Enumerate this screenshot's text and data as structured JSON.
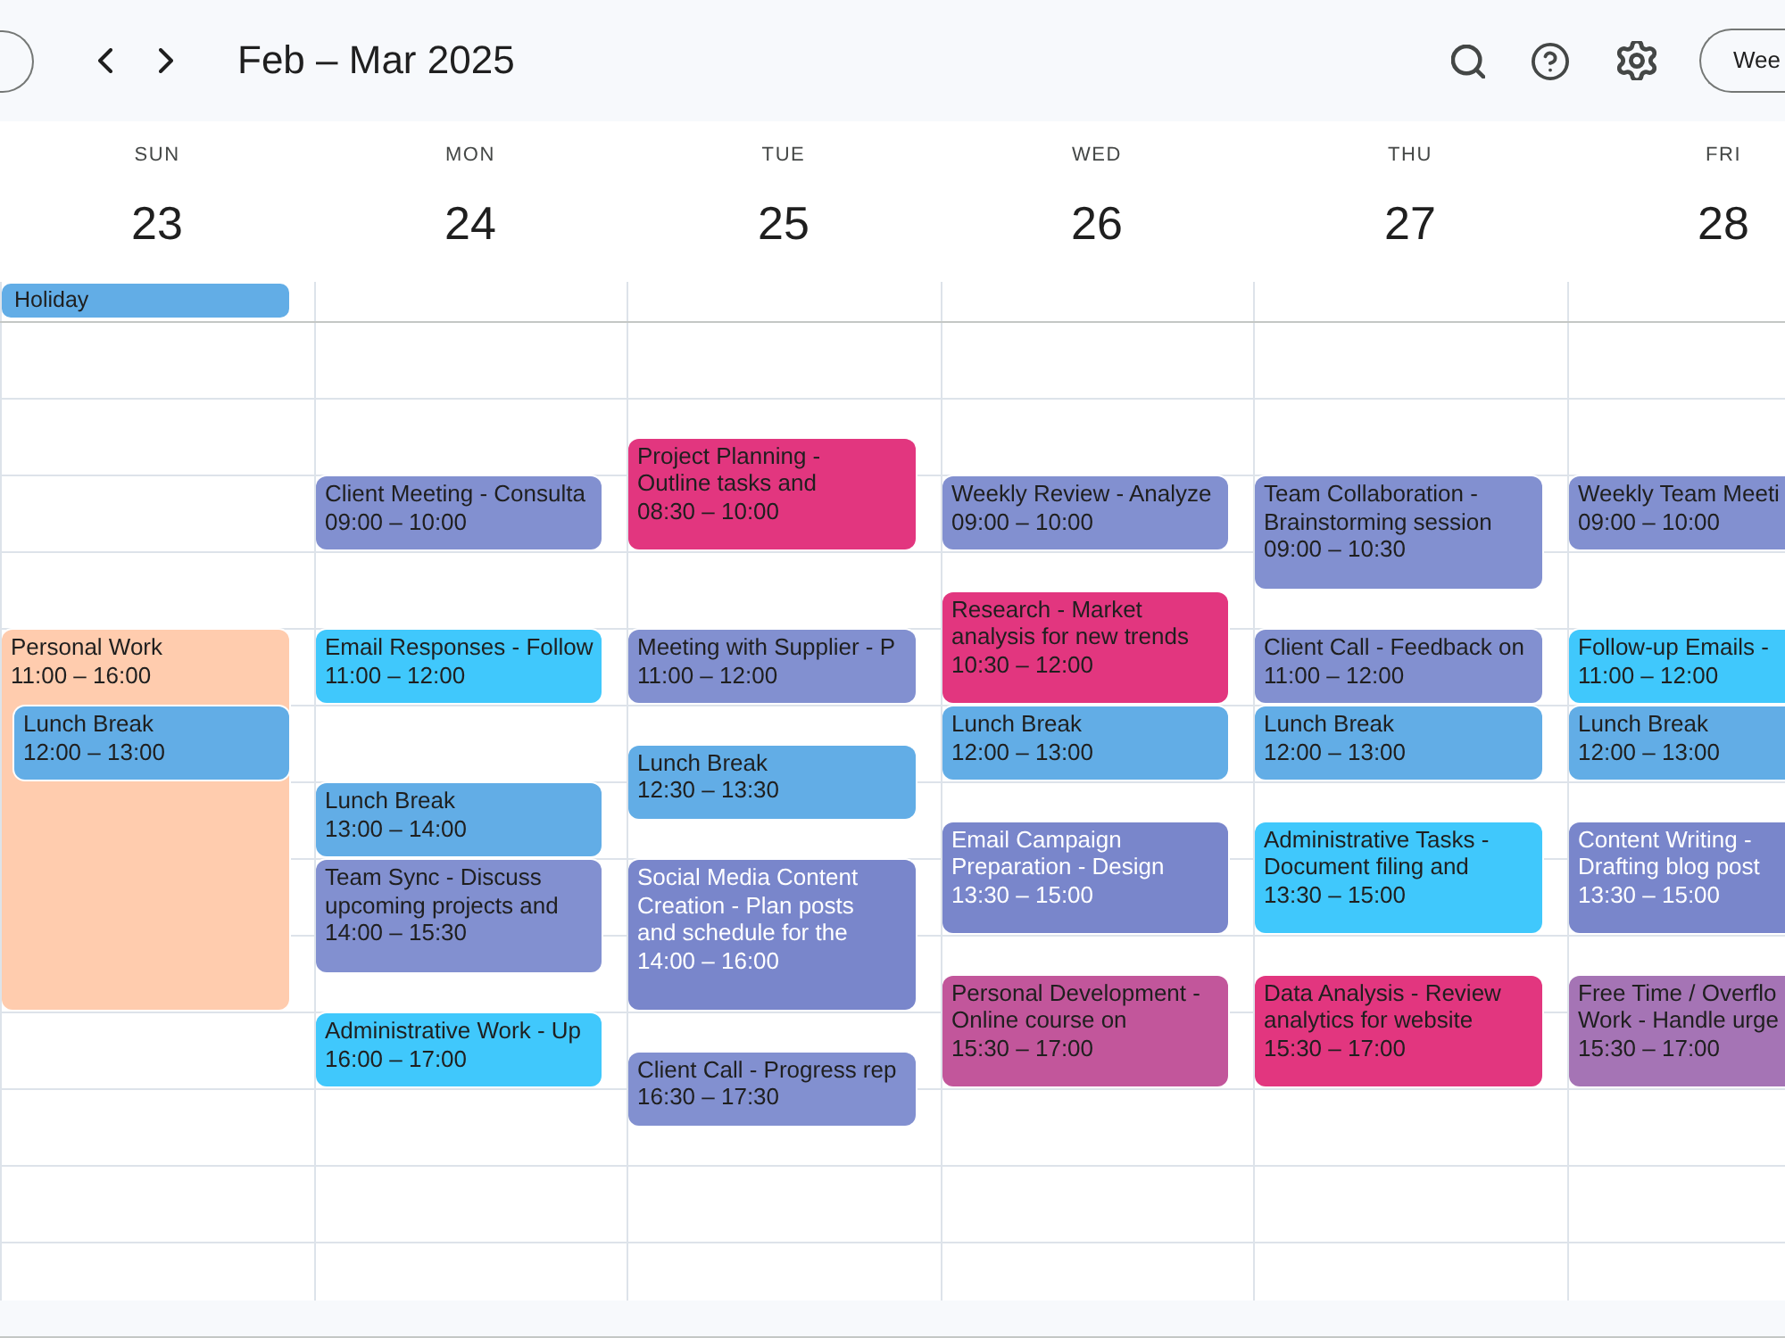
{
  "toolbar": {
    "title": "Feb – Mar 2025",
    "view_button": "Wee"
  },
  "days": [
    {
      "name": "SUN",
      "number": "23",
      "all_day": [
        {
          "title": "Holiday",
          "color": "#62ade6"
        }
      ],
      "events": [
        {
          "title": "Personal Work",
          "time": "11:00 – 16:00",
          "color": "#ffccae",
          "light_text": false
        },
        {
          "title": "Lunch Break",
          "time": "12:00 – 13:00",
          "color": "#62ade6",
          "light_text": false
        }
      ]
    },
    {
      "name": "MON",
      "number": "24",
      "events": [
        {
          "title": "Client Meeting - Consulta",
          "time": "09:00 – 10:00",
          "color": "#8290d0",
          "light_text": false
        },
        {
          "title": "Email Responses - Follow",
          "time": "11:00 – 12:00",
          "color": "#40c8fc",
          "light_text": false
        },
        {
          "title": "Lunch Break",
          "time": "13:00 – 14:00",
          "color": "#62ade6",
          "light_text": false
        },
        {
          "title": "Team Sync - Discuss\nupcoming projects and",
          "time": "14:00 – 15:30",
          "color": "#8290d0",
          "light_text": false
        },
        {
          "title": "Administrative Work - Up",
          "time": "16:00 – 17:00",
          "color": "#40c8fc",
          "light_text": false
        }
      ]
    },
    {
      "name": "TUE",
      "number": "25",
      "events": [
        {
          "title": "Project Planning -\nOutline tasks and",
          "time": "08:30 – 10:00",
          "color": "#e2367f",
          "light_text": false
        },
        {
          "title": "Meeting with Supplier - P",
          "time": "11:00 – 12:00",
          "color": "#8290d0",
          "light_text": false
        },
        {
          "title": "Lunch Break",
          "time": "12:30 – 13:30",
          "color": "#62ade6",
          "light_text": false
        },
        {
          "title": "Social Media Content\nCreation - Plan posts\nand schedule for the",
          "time": "14:00 – 16:00",
          "color": "#7986cb",
          "light_text": true
        },
        {
          "title": "Client Call - Progress rep",
          "time": "16:30 – 17:30",
          "color": "#8290d0",
          "light_text": false
        }
      ]
    },
    {
      "name": "WED",
      "number": "26",
      "events": [
        {
          "title": "Weekly Review - Analyze",
          "time": "09:00 – 10:00",
          "color": "#8290d0",
          "light_text": false
        },
        {
          "title": "Research - Market\nanalysis for new trends",
          "time": "10:30 – 12:00",
          "color": "#e2367f",
          "light_text": false
        },
        {
          "title": "Lunch Break",
          "time": "12:00 – 13:00",
          "color": "#62ade6",
          "light_text": false
        },
        {
          "title": "Email Campaign\nPreparation - Design",
          "time": "13:30 – 15:00",
          "color": "#7986cb",
          "light_text": true
        },
        {
          "title": "Personal Development -\nOnline course on",
          "time": "15:30 – 17:00",
          "color": "#c2569b",
          "light_text": false
        }
      ]
    },
    {
      "name": "THU",
      "number": "27",
      "events": [
        {
          "title": "Team Collaboration -\nBrainstorming session",
          "time": "09:00 – 10:30",
          "color": "#8290d0",
          "light_text": false
        },
        {
          "title": "Client Call - Feedback on",
          "time": "11:00 – 12:00",
          "color": "#8290d0",
          "light_text": false
        },
        {
          "title": "Lunch Break",
          "time": "12:00 – 13:00",
          "color": "#62ade6",
          "light_text": false
        },
        {
          "title": "Administrative Tasks -\nDocument filing and",
          "time": "13:30 – 15:00",
          "color": "#40c8fc",
          "light_text": false
        },
        {
          "title": "Data Analysis - Review\nanalytics for website",
          "time": "15:30 – 17:00",
          "color": "#e2367f",
          "light_text": false
        }
      ]
    },
    {
      "name": "FRI",
      "number": "28",
      "events": [
        {
          "title": "Weekly Team Meeti",
          "time": "09:00 – 10:00",
          "color": "#8290d0",
          "light_text": false
        },
        {
          "title": "Follow-up Emails -",
          "time": "11:00 – 12:00",
          "color": "#40c8fc",
          "light_text": false
        },
        {
          "title": "Lunch Break",
          "time": "12:00 – 13:00",
          "color": "#62ade6",
          "light_text": false
        },
        {
          "title": "Content Writing -\nDrafting blog post",
          "time": "13:30 – 15:00",
          "color": "#7986cb",
          "light_text": true
        },
        {
          "title": "Free Time / Overflo\nWork - Handle urge",
          "time": "15:30 – 17:00",
          "color": "#a574b5",
          "light_text": false
        }
      ]
    }
  ]
}
